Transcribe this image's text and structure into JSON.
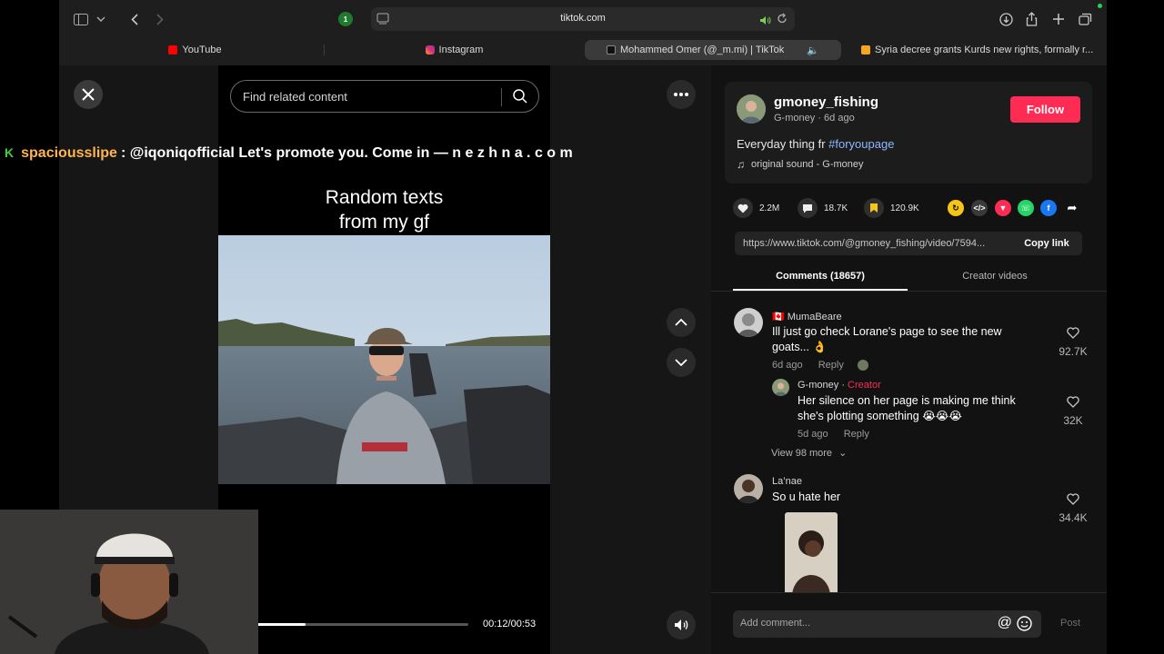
{
  "browser": {
    "url": "tiktok.com",
    "tabs": [
      {
        "label": "YouTube",
        "color": "#ff0000"
      },
      {
        "label": "Instagram",
        "color": "#e1306c"
      },
      {
        "label": "Mohammed Omer (@_m.mi) | TikTok",
        "color": "#000000"
      },
      {
        "label": "Syria decree grants Kurds new rights, formally r...",
        "color": "#f5a623"
      }
    ],
    "extension_badge": "1"
  },
  "player": {
    "search_placeholder": "Find related content",
    "caption_line1": "Random texts",
    "caption_line2": "from my gf",
    "current_time": "00:12/00:53",
    "progress": 0.23
  },
  "stream": {
    "chat_user": "spaciousslipe",
    "chat_message": ": @iqoniqofficial Let's promote you. Come in — n e z h n a . c o m",
    "chat_badge": "K"
  },
  "post": {
    "username": "gmoney_fishing",
    "display_name": "G-money",
    "posted": "6d ago",
    "follow_label": "Follow",
    "description": "Everyday thing fr ",
    "hashtag": "#foryoupage",
    "sound": "original sound - G-money",
    "likes": "2.2M",
    "comments": "18.7K",
    "saves": "120.9K",
    "link": "https://www.tiktok.com/@gmoney_fishing/video/7594...",
    "copy_label": "Copy link",
    "tab_comments": "Comments (18657)",
    "tab_creator": "Creator videos"
  },
  "comments": [
    {
      "name": "🇨🇦 MumaBeare",
      "text1": "Ill just go check Lorane's page to see the new",
      "text2": "goats... 👌",
      "time": "6d ago",
      "reply": "Reply",
      "likes": "92.7K"
    },
    {
      "name": "G-money",
      "badge": "Creator",
      "text1": "Her silence on her page is making me think",
      "text2": "she's plotting something 😭😭😭",
      "time": "5d ago",
      "reply": "Reply",
      "likes": "32K"
    },
    {
      "view_more": "View 98 more"
    },
    {
      "name": "La’nae",
      "text1": "So u hate her",
      "likes": "34.4K"
    }
  ],
  "comment_box": {
    "placeholder": "Add comment...",
    "post_label": "Post"
  }
}
